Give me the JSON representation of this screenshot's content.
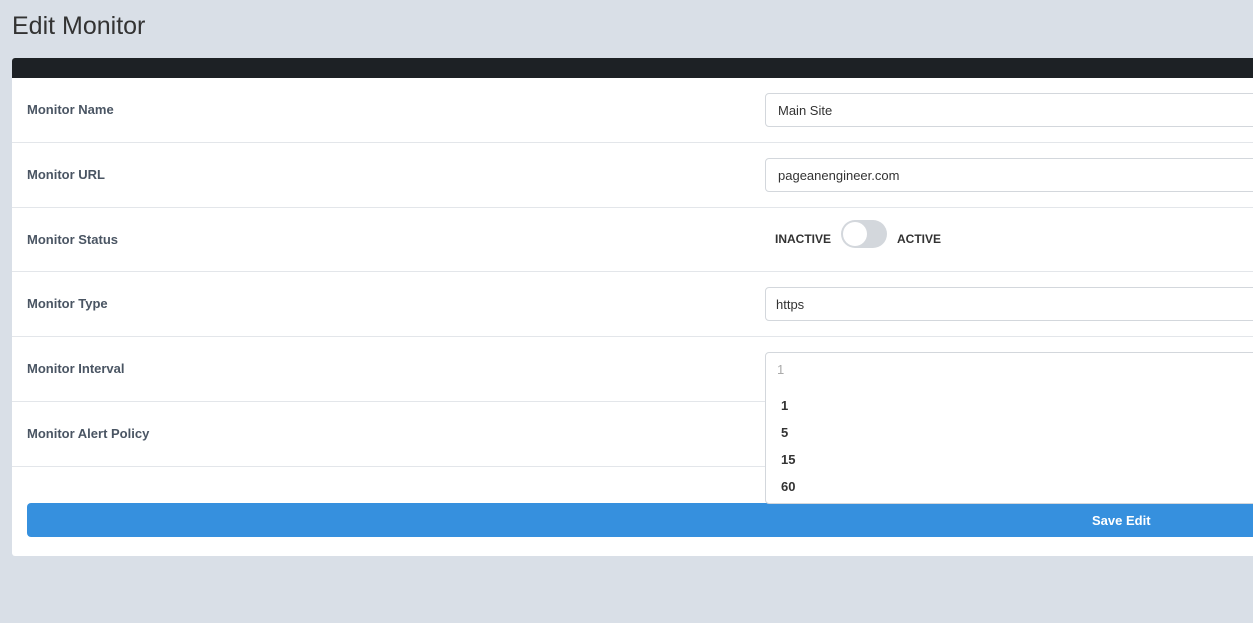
{
  "title": "Edit Monitor",
  "fields": {
    "name": {
      "label": "Monitor Name",
      "value": "Main Site"
    },
    "url": {
      "label": "Monitor URL",
      "value": "pageanengineer.com"
    },
    "status": {
      "label": "Monitor Status",
      "off": "INACTIVE",
      "on": "ACTIVE",
      "checked": false
    },
    "type": {
      "label": "Monitor Type",
      "value": "https"
    },
    "interval": {
      "label": "Monitor Interval",
      "value": "1",
      "options": [
        "1",
        "5",
        "15",
        "60"
      ]
    },
    "alert": {
      "label": "Monitor Alert Policy"
    }
  },
  "save_label": "Save Edit"
}
